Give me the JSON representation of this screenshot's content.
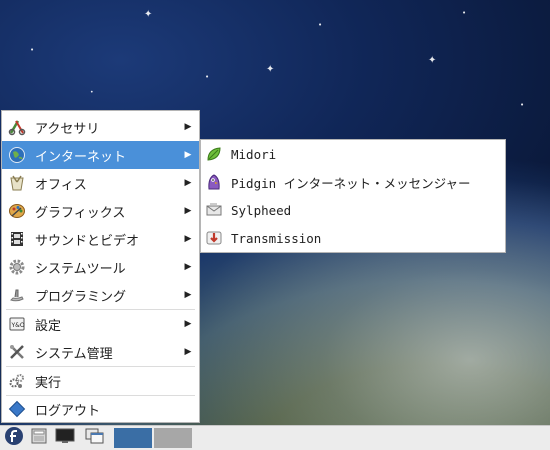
{
  "menu": {
    "items": [
      {
        "label": "アクセサリ",
        "icon": "accessories-icon",
        "has_submenu": true
      },
      {
        "label": "インターネット",
        "icon": "globe-icon",
        "has_submenu": true,
        "active": true
      },
      {
        "label": "オフィス",
        "icon": "office-icon",
        "has_submenu": true
      },
      {
        "label": "グラフィックス",
        "icon": "palette-icon",
        "has_submenu": true
      },
      {
        "label": "サウンドとビデオ",
        "icon": "film-icon",
        "has_submenu": true
      },
      {
        "label": "システムツール",
        "icon": "gear-icon",
        "has_submenu": true
      },
      {
        "label": "プログラミング",
        "icon": "programming-icon",
        "has_submenu": true
      },
      {
        "label": "設定",
        "icon": "settings-icon",
        "has_submenu": true
      },
      {
        "label": "システム管理",
        "icon": "tools-icon",
        "has_submenu": true
      },
      {
        "label": "実行",
        "icon": "run-icon",
        "has_submenu": false
      },
      {
        "label": "ログアウト",
        "icon": "logout-icon",
        "has_submenu": false
      }
    ]
  },
  "submenu": {
    "items": [
      {
        "label": "Midori",
        "icon": "midori-leaf-icon"
      },
      {
        "label": "Pidgin インターネット・メッセンジャー",
        "icon": "pidgin-icon"
      },
      {
        "label": "Sylpheed",
        "icon": "mail-icon"
      },
      {
        "label": "Transmission",
        "icon": "transmission-icon"
      }
    ]
  },
  "taskbar": {
    "buttons": [
      "fedora-menu-icon",
      "file-manager-icon",
      "terminal-icon",
      "desktop-switch-icon"
    ],
    "workspaces": 2
  },
  "colors": {
    "highlight": "#4a90d9",
    "menu_bg": "#ffffff",
    "taskbar_bg": "#ececec"
  }
}
